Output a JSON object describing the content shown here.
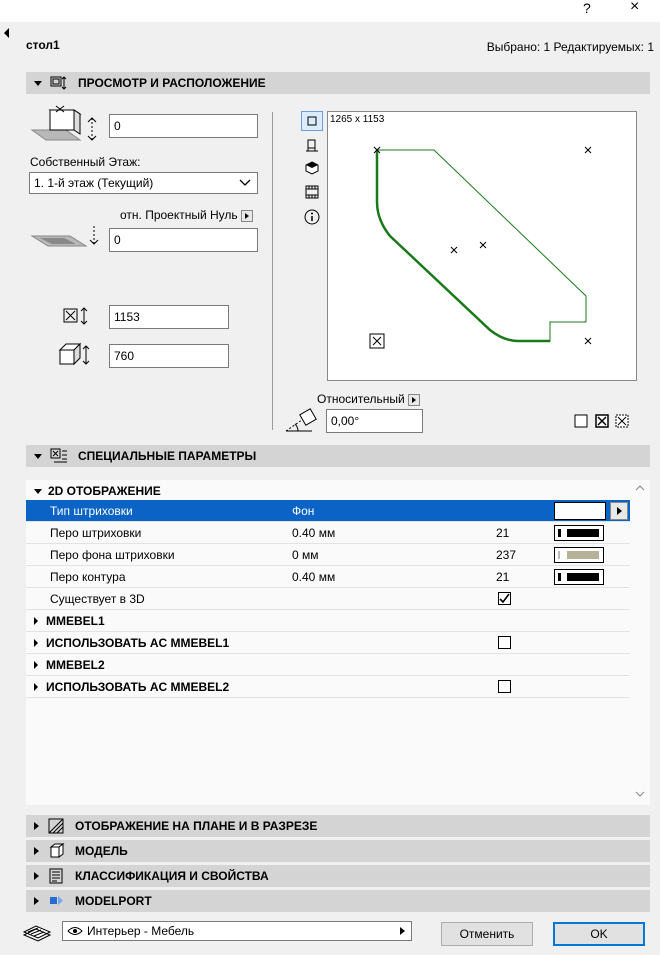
{
  "window": {
    "help_label": "?",
    "close_label": "×"
  },
  "header": {
    "title": "стол1",
    "selection": "Выбрано: 1 Редактируемых: 1"
  },
  "sections": {
    "preview": "ПРОСМОТР И РАСПОЛОЖЕНИЕ",
    "special": "СПЕЦИАЛЬНЫЕ ПАРАМЕТРЫ",
    "plan": "ОТОБРАЖЕНИЕ НА ПЛАНЕ И В РАЗРЕЗЕ",
    "model": "МОДЕЛЬ",
    "classification": "КЛАССИФИКАЦИЯ И СВОЙСТВА",
    "modelport": "MODELPORT"
  },
  "placement": {
    "elevation_value": "0",
    "home_story_label": "Собственный Этаж:",
    "home_story_value": "1. 1-й этаж (Текущий)",
    "reference_label": "отн. Проектный Нуль",
    "reference_value": "0",
    "width_value": "1153",
    "height_value": "760"
  },
  "preview_panel": {
    "dimension_text": "1265 x 1153",
    "relative_label": "Относительный",
    "angle_value": "0,00°"
  },
  "params": {
    "group_2d": "2D ОТОБРАЖЕНИЕ",
    "rows": [
      {
        "name": "Тип штриховки",
        "value": "Фон",
        "num": ""
      },
      {
        "name": "Перо штриховки",
        "value": "0.40 мм",
        "num": "21"
      },
      {
        "name": "Перо фона штриховки",
        "value": "0 мм",
        "num": "237"
      },
      {
        "name": "Перо контура",
        "value": "0.40 мм",
        "num": "21"
      },
      {
        "name": "Существует в 3D",
        "value": "",
        "num": ""
      }
    ],
    "groups": [
      "MMEBEL1",
      "ИСПОЛЬЗОВАТЬ AC MMEBEL1",
      "MMEBEL2",
      "ИСПОЛЬЗОВАТЬ AC MMEBEL2"
    ],
    "exists_in_3d": true
  },
  "footer": {
    "layer": "Интерьер - Мебель",
    "cancel": "Отменить",
    "ok": "OK"
  },
  "colors": {
    "selection": "#0b63c5",
    "section_header": "#d4d4d4",
    "outline_green": "#1a7a1a",
    "ok_border": "#0078d7"
  }
}
